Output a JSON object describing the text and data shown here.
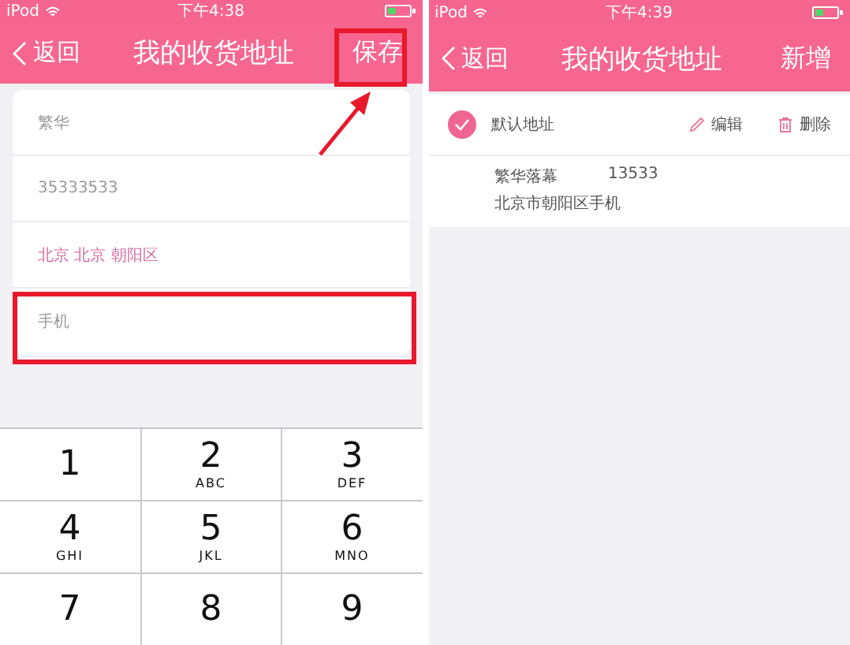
{
  "screens": [
    {
      "status_bar": {
        "carrier": "iPod",
        "time": "下午4:38"
      },
      "nav": {
        "back": "返回",
        "title": "我的收货地址",
        "action": "保存"
      },
      "form": [
        {
          "kind": "input",
          "value": "繁华"
        },
        {
          "kind": "input",
          "value": "35333533"
        },
        {
          "kind": "picker",
          "value": "北京 北京 朝阳区"
        },
        {
          "kind": "input",
          "placeholder": "手机"
        }
      ],
      "keypad": [
        [
          {
            "digit": "1"
          },
          {
            "digit": "2",
            "letters": "ABC"
          },
          {
            "digit": "3",
            "letters": "DEF"
          }
        ],
        [
          {
            "digit": "4",
            "letters": "GHI"
          },
          {
            "digit": "5",
            "letters": "JKL"
          },
          {
            "digit": "6",
            "letters": "MNO"
          }
        ],
        [
          {
            "digit": "7"
          },
          {
            "digit": "8"
          },
          {
            "digit": "9"
          }
        ]
      ]
    },
    {
      "status_bar": {
        "carrier": "iPod",
        "time": "下午4:39"
      },
      "nav": {
        "back": "返回",
        "title": "我的收货地址",
        "action": "新增"
      },
      "addresses": [
        {
          "default_checked": true,
          "default_label": "默认地址",
          "edit": "编辑",
          "delete": "删除",
          "name": "繁华落幕",
          "phone": "13533",
          "address": "北京市朝阳区手机"
        }
      ]
    }
  ]
}
